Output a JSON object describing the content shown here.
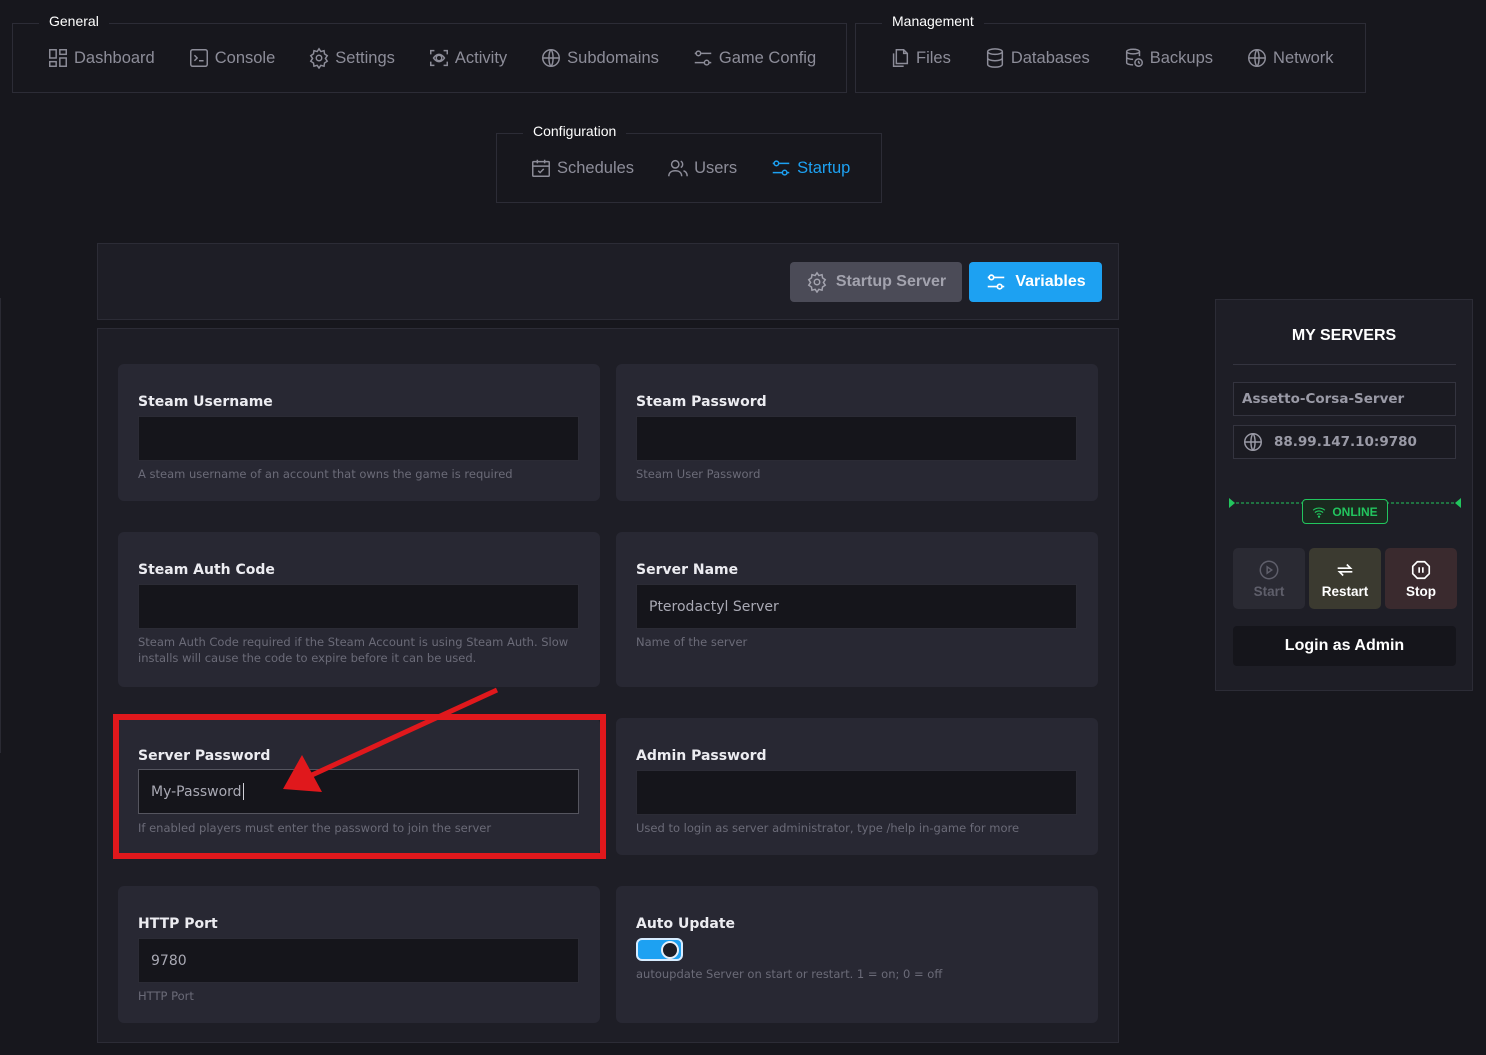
{
  "nav": {
    "general": {
      "title": "General",
      "items": [
        {
          "label": "Dashboard",
          "icon": "dashboard-icon"
        },
        {
          "label": "Console",
          "icon": "console-icon"
        },
        {
          "label": "Settings",
          "icon": "gear-icon"
        },
        {
          "label": "Activity",
          "icon": "activity-icon"
        },
        {
          "label": "Subdomains",
          "icon": "globe-icon"
        },
        {
          "label": "Game Config",
          "icon": "sliders-icon"
        }
      ]
    },
    "management": {
      "title": "Management",
      "items": [
        {
          "label": "Files",
          "icon": "files-icon"
        },
        {
          "label": "Databases",
          "icon": "database-icon"
        },
        {
          "label": "Backups",
          "icon": "backup-icon"
        },
        {
          "label": "Network",
          "icon": "globe-icon"
        }
      ]
    },
    "configuration": {
      "title": "Configuration",
      "items": [
        {
          "label": "Schedules",
          "icon": "calendar-icon"
        },
        {
          "label": "Users",
          "icon": "users-icon"
        },
        {
          "label": "Startup",
          "icon": "sliders-icon",
          "active": true
        }
      ]
    }
  },
  "toolbar": {
    "startup_server_label": "Startup Server",
    "variables_label": "Variables"
  },
  "variables": {
    "steam_username": {
      "label": "Steam Username",
      "value": "",
      "help": "A steam username of an account that owns the game is required"
    },
    "steam_password": {
      "label": "Steam Password",
      "value": "",
      "help": "Steam User Password"
    },
    "steam_auth_code": {
      "label": "Steam Auth Code",
      "value": "",
      "help": "Steam Auth Code required if the Steam Account is using Steam Auth. Slow installs will cause the code to expire before it can be used."
    },
    "server_name": {
      "label": "Server Name",
      "value": "Pterodactyl Server",
      "help": "Name of the server"
    },
    "server_password": {
      "label": "Server Password",
      "value": "My-Password",
      "help": "If enabled players must enter the password to join the server"
    },
    "admin_password": {
      "label": "Admin Password",
      "value": "",
      "help": "Used to login as server administrator, type /help in-game for more"
    },
    "http_port": {
      "label": "HTTP Port",
      "value": "9780",
      "help": "HTTP Port"
    },
    "auto_update": {
      "label": "Auto Update",
      "enabled": true,
      "help": "autoupdate Server on start or restart. 1 = on; 0 = off"
    }
  },
  "sidebar": {
    "title": "MY SERVERS",
    "server_name": "Assetto-Corsa-Server",
    "address": "88.99.147.10:9780",
    "status": "ONLINE",
    "start_label": "Start",
    "restart_label": "Restart",
    "stop_label": "Stop",
    "login_label": "Login as Admin"
  },
  "colors": {
    "accent": "#1da1f2",
    "online": "#22c55e",
    "annotation": "#e0181c"
  }
}
